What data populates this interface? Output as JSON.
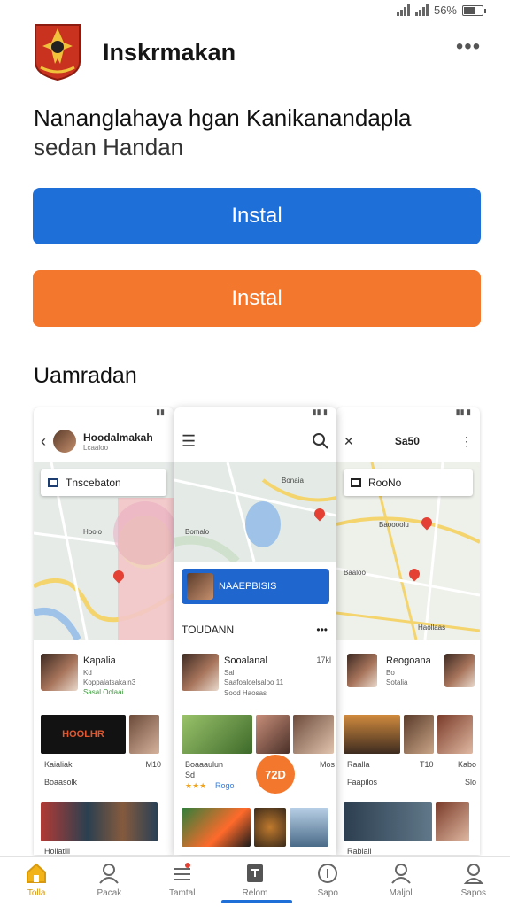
{
  "status_bar": {
    "battery_text": "56%"
  },
  "header": {
    "app_name": "Inskrmakan"
  },
  "headline": {
    "line1": "Nananglahaya hgan Kanikanandapla",
    "line2": "sedan Handan"
  },
  "buttons": {
    "install_primary": "Instal",
    "install_secondary": "Instal"
  },
  "screenshots_title": "Uamradan",
  "colors": {
    "primary_blue": "#1f6fd8",
    "accent_orange": "#f3772c",
    "active_nav": "#d89a10"
  },
  "shots": {
    "left": {
      "title": "Hoodalmakah",
      "subtitle": "Lcaaloo",
      "search_text": "Tnscebaton",
      "map_label": "Hoolo",
      "item": {
        "title": "Kapalia",
        "line1": "Kd",
        "line2": "Koppalatsakaln3",
        "line3": "Sasal Oolaai"
      },
      "banner_text": "HOOLHR",
      "caption1": "Kaialiak",
      "caption1_meta": "M10",
      "caption2": "Boaasolk",
      "caption3": "Hollatiii"
    },
    "center": {
      "map_label1": "Bonaia",
      "map_label2": "Bomalo",
      "banner_text": "NAAEPBISIS",
      "section_title": "TOUDANN",
      "item": {
        "title": "Sooalanal",
        "meta": "17kl",
        "line1": "Sal",
        "line2": "Saafoalcelsaloo 11",
        "line3": "Sood Haosas"
      },
      "caption1": "Boaaaulun",
      "caption1_meta": "Mos",
      "caption2": "Sd",
      "caption3": "Rogo",
      "fab_text": "72D"
    },
    "right": {
      "title": "Sa50",
      "search_text": "RooNo",
      "map_label1": "Baoooolu",
      "map_label2": "Baaloo",
      "map_label3": "Haollaas",
      "item": {
        "title": "Reogoana",
        "line1": "Bo",
        "line2": "Sotalia"
      },
      "caption1": "Raalla",
      "caption1_meta": "T10",
      "caption1_b": "Kabo",
      "caption2": "Faapilos",
      "caption2_meta": "Slo",
      "caption3": "Rabiail"
    }
  },
  "nav": [
    {
      "label": "Tolla",
      "icon": "home-icon"
    },
    {
      "label": "Pacak",
      "icon": "person-icon"
    },
    {
      "label": "Tamtal",
      "icon": "list-icon"
    },
    {
      "label": "Relom",
      "icon": "book-icon"
    },
    {
      "label": "Sapo",
      "icon": "info-icon"
    },
    {
      "label": "Maljol",
      "icon": "account-icon"
    },
    {
      "label": "Sapos",
      "icon": "profile-icon"
    }
  ]
}
